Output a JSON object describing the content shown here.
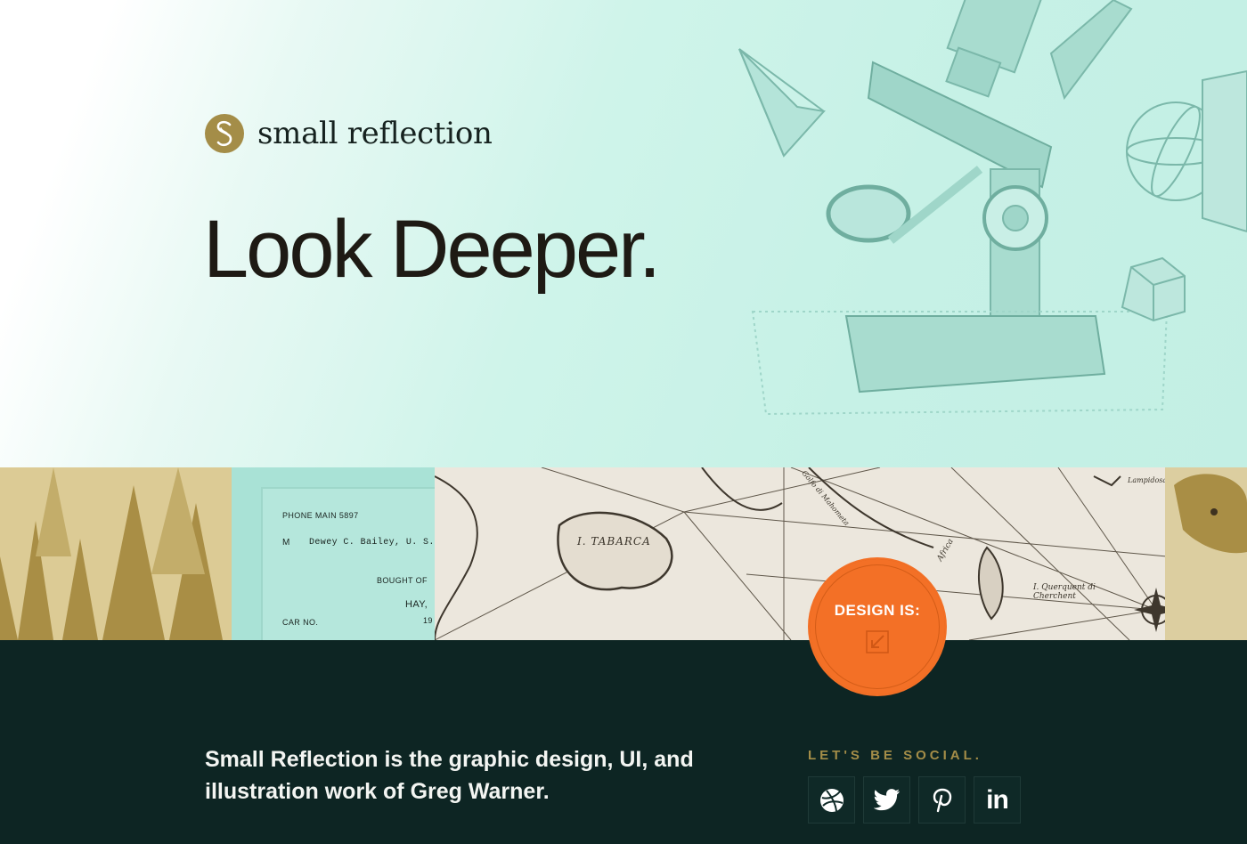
{
  "brand": {
    "name": "small reflection",
    "logo_letter": "S"
  },
  "hero": {
    "headline": "Look Deeper."
  },
  "strip": {
    "receipt": {
      "phone": "PHONE MAIN 5897",
      "m": "M",
      "customer": "Dewey C. Bailey, U. S.",
      "bought": "BOUGHT OF",
      "item": "HAY,",
      "car": "CAR NO.",
      "year": "19"
    },
    "map_labels": [
      "I. TABARCA",
      "I. Querquent di Cherchent",
      "Lampidosa",
      "Africa",
      "Golfo di Mahometa"
    ]
  },
  "cta": {
    "label": "DESIGN IS:",
    "icon": "arrow-up-left-icon",
    "color": "#f37026"
  },
  "footer": {
    "about": "Small Reflection is the graphic design, UI, and illustration work of Greg Warner.",
    "social_heading": "LET'S BE SOCIAL.",
    "social": [
      {
        "name": "Dribbble",
        "icon": "dribbble-icon"
      },
      {
        "name": "Twitter",
        "icon": "twitter-icon"
      },
      {
        "name": "Pinterest",
        "icon": "pinterest-icon"
      },
      {
        "name": "LinkedIn",
        "icon": "linkedin-icon",
        "text": "in"
      }
    ]
  },
  "colors": {
    "gold": "#a48d48",
    "mint": "#c6f1e6",
    "dark": "#0d2523",
    "orange": "#f37026"
  }
}
